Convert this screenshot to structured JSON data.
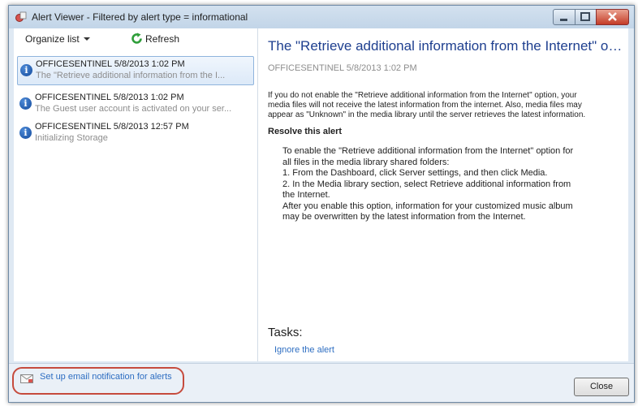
{
  "window": {
    "title": "Alert Viewer - Filtered by alert type = informational"
  },
  "toolbar": {
    "organize_label": "Organize list",
    "refresh_label": "Refresh"
  },
  "alerts": [
    {
      "title": "OFFICESENTINEL 5/8/2013 1:02 PM",
      "summary": "The \"Retrieve additional information from the I...",
      "selected": true
    },
    {
      "title": "OFFICESENTINEL 5/8/2013 1:02 PM",
      "summary": "The Guest user account is activated on your ser..."
    },
    {
      "title": "OFFICESENTINEL 5/8/2013 12:57 PM",
      "summary": "Initializing Storage"
    }
  ],
  "detail": {
    "title": "The \"Retrieve additional information from the Internet\" opti...",
    "source": "OFFICESENTINEL 5/8/2013 1:02 PM",
    "body_lines": [
      "If you do not enable the \"Retrieve additional information from the Internet\" option, your",
      "media files will not receive the latest information from the internet. Also, media files may",
      "appear as \"Unknown\" in the media library until the server retrieves the latest information."
    ],
    "resolve_heading": "Resolve this alert",
    "resolve_lines": [
      "To enable the \"Retrieve additional information from the Internet\" option for",
      "all files in the media library shared folders:",
      "1. From the Dashboard, click Server settings, and then click Media.",
      "2. In the Media library section, select Retrieve additional information from",
      "the Internet.",
      "After you enable this option, information for your customized music album",
      "may be overwritten by the latest information from the Internet."
    ],
    "tasks_label": "Tasks:",
    "task_link": "Ignore the alert"
  },
  "footer": {
    "email_link": "Set up email notification for alerts",
    "close_label": "Close"
  },
  "colors": {
    "title_blue": "#1e3f8f",
    "link_blue": "#2e6ec2",
    "highlight_red": "#c64b3d",
    "info_blue": "#144b9c"
  },
  "icons": {
    "app": "alert-viewer-icon",
    "refresh": "refresh-icon",
    "info": "info-icon",
    "mail": "mail-icon"
  }
}
